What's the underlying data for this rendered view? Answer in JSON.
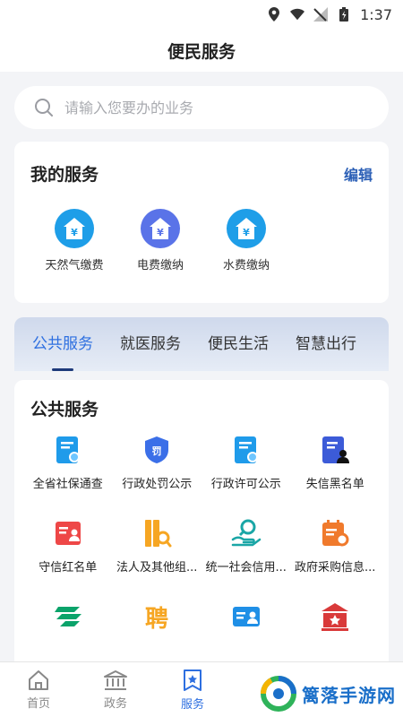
{
  "status_bar": {
    "time": "1:37"
  },
  "header": {
    "title": "便民服务"
  },
  "search": {
    "placeholder": "请输入您要办的业务"
  },
  "my_services": {
    "title": "我的服务",
    "edit_label": "编辑",
    "items": [
      {
        "label": "天然气缴费",
        "icon": "gas-bill-icon",
        "color": "#1e9ee8"
      },
      {
        "label": "电费缴纳",
        "icon": "electric-bill-icon",
        "color": "#5a73e8"
      },
      {
        "label": "水费缴纳",
        "icon": "water-bill-icon",
        "color": "#1e9ee8"
      }
    ]
  },
  "tabs": [
    {
      "label": "公共服务",
      "active": true
    },
    {
      "label": "就医服务"
    },
    {
      "label": "便民生活"
    },
    {
      "label": "智慧出行"
    }
  ],
  "public_services": {
    "title": "公共服务",
    "items": [
      {
        "label": "全省社保通查",
        "icon": "social-security-icon"
      },
      {
        "label": "行政处罚公示",
        "icon": "penalty-shield-icon"
      },
      {
        "label": "行政许可公示",
        "icon": "permit-icon"
      },
      {
        "label": "失信黑名单",
        "icon": "blacklist-icon"
      },
      {
        "label": "守信红名单",
        "icon": "redlist-icon"
      },
      {
        "label": "法人及其他组...",
        "icon": "legal-person-icon"
      },
      {
        "label": "统一社会信用...",
        "icon": "credit-code-icon"
      },
      {
        "label": "政府采购信息...",
        "icon": "procurement-icon"
      },
      {
        "label": "",
        "icon": "postal-icon"
      },
      {
        "label": "",
        "icon": "recruit-icon"
      },
      {
        "label": "",
        "icon": "id-card-icon"
      },
      {
        "label": "",
        "icon": "institution-icon"
      }
    ]
  },
  "bottom_nav": [
    {
      "label": "首页",
      "icon": "home-icon"
    },
    {
      "label": "政务",
      "icon": "government-icon"
    },
    {
      "label": "服务",
      "icon": "service-icon",
      "active": true
    }
  ],
  "watermark": {
    "text": "篱落手游网"
  },
  "colors": {
    "accent": "#2d6fe0",
    "edit": "#2b5fb6",
    "tab_underline": "#1e3a7a"
  }
}
